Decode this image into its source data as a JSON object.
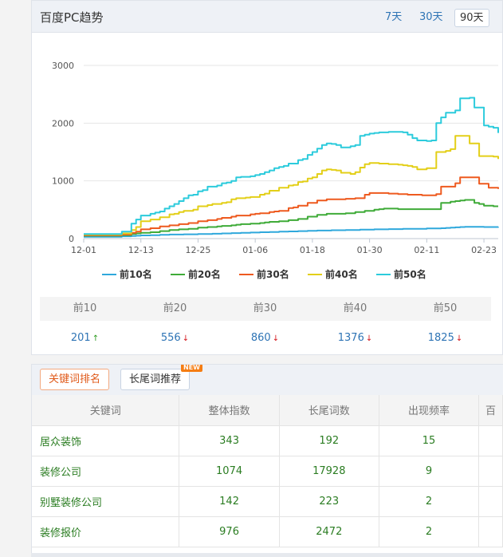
{
  "trend": {
    "title": "百度PC趋势",
    "ranges": [
      "7天",
      "30天",
      "90天"
    ],
    "active_range": "90天"
  },
  "chart_data": {
    "type": "line",
    "x": [
      "12-01",
      "12-02",
      "12-03",
      "12-04",
      "12-05",
      "12-06",
      "12-07",
      "12-08",
      "12-09",
      "12-10",
      "12-11",
      "12-12",
      "12-13",
      "12-14",
      "12-15",
      "12-16",
      "12-17",
      "12-18",
      "12-19",
      "12-20",
      "12-21",
      "12-22",
      "12-23",
      "12-24",
      "12-25",
      "12-26",
      "12-27",
      "12-28",
      "12-29",
      "12-30",
      "12-31",
      "01-01",
      "01-02",
      "01-03",
      "01-04",
      "01-05",
      "01-06",
      "01-07",
      "01-08",
      "01-09",
      "01-10",
      "01-11",
      "01-12",
      "01-13",
      "01-14",
      "01-15",
      "01-16",
      "01-17",
      "01-18",
      "01-19",
      "01-20",
      "01-21",
      "01-22",
      "01-23",
      "01-24",
      "01-25",
      "01-26",
      "01-27",
      "01-28",
      "01-29",
      "01-30",
      "01-31",
      "02-01",
      "02-02",
      "02-03",
      "02-04",
      "02-05",
      "02-06",
      "02-07",
      "02-08",
      "02-09",
      "02-10",
      "02-11",
      "02-12",
      "02-13",
      "02-14",
      "02-15",
      "02-16",
      "02-17",
      "02-18",
      "02-19",
      "02-20",
      "02-21",
      "02-22",
      "02-23",
      "02-24",
      "02-25",
      "02-26"
    ],
    "x_ticks": [
      "12-01",
      "12-13",
      "12-25",
      "01-06",
      "01-18",
      "01-30",
      "02-11",
      "02-23"
    ],
    "y_ticks": [
      0,
      1000,
      2000,
      3000
    ],
    "ylim": [
      0,
      3000
    ],
    "series": [
      {
        "name": "前10名",
        "color": "#2fa8dc",
        "values": [
          30,
          30,
          30,
          30,
          30,
          30,
          30,
          30,
          40,
          40,
          45,
          50,
          55,
          55,
          60,
          60,
          65,
          65,
          70,
          70,
          70,
          75,
          75,
          75,
          80,
          80,
          80,
          85,
          85,
          90,
          90,
          95,
          95,
          100,
          100,
          105,
          105,
          110,
          110,
          115,
          115,
          120,
          120,
          125,
          125,
          130,
          130,
          135,
          135,
          140,
          140,
          140,
          145,
          145,
          145,
          150,
          150,
          150,
          155,
          155,
          155,
          160,
          160,
          160,
          165,
          165,
          165,
          170,
          170,
          170,
          170,
          170,
          175,
          175,
          175,
          180,
          185,
          190,
          195,
          200,
          205,
          205,
          205,
          205,
          200,
          200,
          200,
          205
        ]
      },
      {
        "name": "前20名",
        "color": "#3fab38",
        "values": [
          50,
          50,
          50,
          50,
          50,
          50,
          50,
          50,
          60,
          60,
          80,
          90,
          100,
          100,
          110,
          110,
          130,
          130,
          150,
          150,
          160,
          160,
          170,
          170,
          190,
          190,
          200,
          200,
          210,
          220,
          220,
          230,
          240,
          250,
          250,
          260,
          260,
          270,
          280,
          290,
          290,
          300,
          300,
          320,
          320,
          340,
          340,
          380,
          380,
          410,
          410,
          430,
          430,
          430,
          430,
          440,
          440,
          460,
          460,
          480,
          480,
          500,
          510,
          520,
          520,
          520,
          510,
          510,
          510,
          510,
          510,
          510,
          510,
          510,
          510,
          620,
          620,
          640,
          650,
          660,
          670,
          670,
          620,
          600,
          570,
          570,
          560,
          560
        ]
      },
      {
        "name": "前30名",
        "color": "#ee5a1f",
        "values": [
          60,
          60,
          60,
          60,
          60,
          60,
          60,
          60,
          70,
          70,
          100,
          120,
          160,
          160,
          180,
          180,
          210,
          210,
          230,
          230,
          250,
          250,
          270,
          270,
          300,
          300,
          320,
          320,
          340,
          360,
          360,
          380,
          400,
          400,
          400,
          420,
          430,
          440,
          440,
          460,
          470,
          480,
          480,
          530,
          540,
          570,
          570,
          620,
          620,
          660,
          660,
          680,
          680,
          680,
          680,
          690,
          690,
          700,
          700,
          760,
          790,
          790,
          790,
          790,
          780,
          780,
          770,
          770,
          760,
          760,
          760,
          750,
          750,
          750,
          770,
          900,
          900,
          900,
          960,
          1060,
          1060,
          1060,
          1060,
          950,
          950,
          880,
          880,
          860
        ]
      },
      {
        "name": "前40名",
        "color": "#e3cf18",
        "values": [
          70,
          70,
          70,
          70,
          70,
          70,
          70,
          70,
          90,
          90,
          150,
          200,
          300,
          300,
          330,
          330,
          370,
          370,
          420,
          430,
          460,
          480,
          480,
          500,
          560,
          560,
          580,
          600,
          600,
          620,
          630,
          680,
          700,
          700,
          710,
          720,
          720,
          760,
          780,
          830,
          830,
          880,
          880,
          920,
          930,
          980,
          990,
          1040,
          1060,
          1120,
          1180,
          1200,
          1190,
          1180,
          1140,
          1140,
          1120,
          1150,
          1230,
          1290,
          1310,
          1310,
          1300,
          1300,
          1290,
          1290,
          1280,
          1270,
          1260,
          1240,
          1200,
          1200,
          1220,
          1220,
          1500,
          1500,
          1520,
          1550,
          1780,
          1780,
          1780,
          1650,
          1650,
          1430,
          1430,
          1430,
          1420,
          1380
        ]
      },
      {
        "name": "前50名",
        "color": "#2ccbdc",
        "values": [
          80,
          80,
          80,
          80,
          80,
          80,
          80,
          80,
          120,
          120,
          260,
          330,
          400,
          400,
          430,
          450,
          470,
          520,
          560,
          600,
          650,
          700,
          750,
          760,
          820,
          840,
          900,
          900,
          920,
          960,
          970,
          1000,
          1060,
          1070,
          1070,
          1080,
          1100,
          1120,
          1150,
          1180,
          1220,
          1240,
          1260,
          1300,
          1300,
          1360,
          1380,
          1450,
          1500,
          1560,
          1620,
          1650,
          1640,
          1620,
          1580,
          1580,
          1600,
          1620,
          1780,
          1800,
          1820,
          1830,
          1840,
          1840,
          1850,
          1850,
          1850,
          1840,
          1800,
          1740,
          1700,
          1700,
          1690,
          1700,
          2000,
          2100,
          2180,
          2180,
          2220,
          2430,
          2430,
          2440,
          2270,
          2270,
          1960,
          1940,
          1920,
          1830
        ]
      }
    ]
  },
  "stats": {
    "headers": [
      "前10",
      "前20",
      "前30",
      "前40",
      "前50"
    ],
    "values": [
      "201",
      "556",
      "860",
      "1376",
      "1825"
    ],
    "arrows": [
      "↑",
      "↓",
      "↓",
      "↓",
      "↓"
    ]
  },
  "keywords": {
    "tabs": [
      "关键词排名",
      "长尾词推荐"
    ],
    "badge": "NEW",
    "columns": [
      "关键词",
      "整体指数",
      "长尾词数",
      "出现频率",
      "百"
    ],
    "rows": [
      [
        "居众装饰",
        "343",
        "192",
        "15"
      ],
      [
        "装修公司",
        "1074",
        "17928",
        "9"
      ],
      [
        "别墅装修公司",
        "142",
        "223",
        "2"
      ],
      [
        "装修报价",
        "976",
        "2472",
        "2"
      ]
    ]
  }
}
